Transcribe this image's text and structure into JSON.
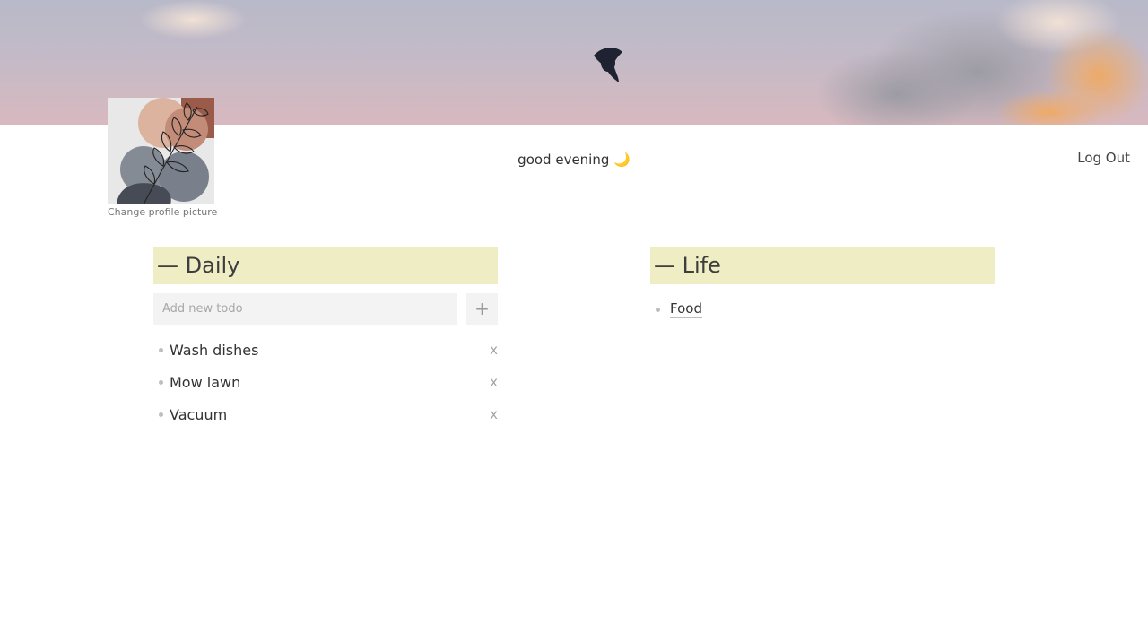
{
  "banner": {
    "image": "evening-sky-with-bird"
  },
  "profile": {
    "avatar": "abstract-leaf-artwork",
    "change_picture_label": "Change profile picture"
  },
  "header": {
    "greeting": "good evening 🌙",
    "logout_label": "Log Out"
  },
  "lists": {
    "daily": {
      "title": "— Daily",
      "add_placeholder": "Add new todo",
      "add_button": "+",
      "remove_label": "x",
      "items": [
        "Wash dishes",
        "Mow lawn",
        "Vacuum"
      ]
    },
    "life": {
      "title": "— Life",
      "items": [
        "Food"
      ]
    }
  },
  "colors": {
    "header_band": "#efedc4",
    "input_bg": "#f3f3f3",
    "bullet": "#bdbdbd"
  }
}
